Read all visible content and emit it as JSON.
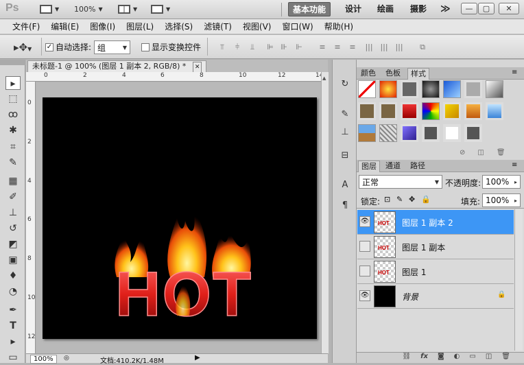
{
  "app": {
    "logo": "Ps",
    "zoom": "100%",
    "workspaces": [
      "基本功能",
      "设计",
      "绘画",
      "摄影"
    ],
    "more": "≫",
    "window_controls": [
      "—",
      "▢",
      "✕"
    ]
  },
  "menu": [
    "文件(F)",
    "编辑(E)",
    "图像(I)",
    "图层(L)",
    "选择(S)",
    "滤镜(T)",
    "视图(V)",
    "窗口(W)",
    "帮助(H)"
  ],
  "options": {
    "auto_select_label": "自动选择:",
    "auto_select_value": "组",
    "transform_label": "显示变换控件"
  },
  "document": {
    "tab_title": "未标题-1 @ 100% (图层 1 副本 2, RGB/8) *",
    "close": "✕",
    "art_text": "HOT",
    "zoom": "100%",
    "doc_info": "文档:410.2K/1.48M",
    "ruler_top": [
      "0",
      "2",
      "4",
      "6",
      "8",
      "10",
      "12",
      "14"
    ],
    "ruler_left": [
      "0",
      "2",
      "4",
      "6",
      "8",
      "10",
      "12"
    ]
  },
  "swatch_panel": {
    "tabs": [
      "颜色",
      "色板",
      "样式"
    ]
  },
  "layers_panel": {
    "tabs": [
      "图层",
      "通道",
      "路径"
    ],
    "blend_mode": "正常",
    "opacity_label": "不透明度:",
    "opacity": "100%",
    "lock_label": "锁定:",
    "fill_label": "填充:",
    "fill": "100%",
    "layers": [
      {
        "name": "图层 1 副本 2",
        "visible": true,
        "selected": true
      },
      {
        "name": "图层 1 副本",
        "visible": false,
        "selected": false
      },
      {
        "name": "图层 1",
        "visible": false,
        "selected": false
      },
      {
        "name": "背景",
        "visible": true,
        "selected": false
      }
    ],
    "thumb_text": "HOT"
  },
  "colors": {
    "selected_row": "#3d96f5",
    "text_red": "#e0201a"
  }
}
